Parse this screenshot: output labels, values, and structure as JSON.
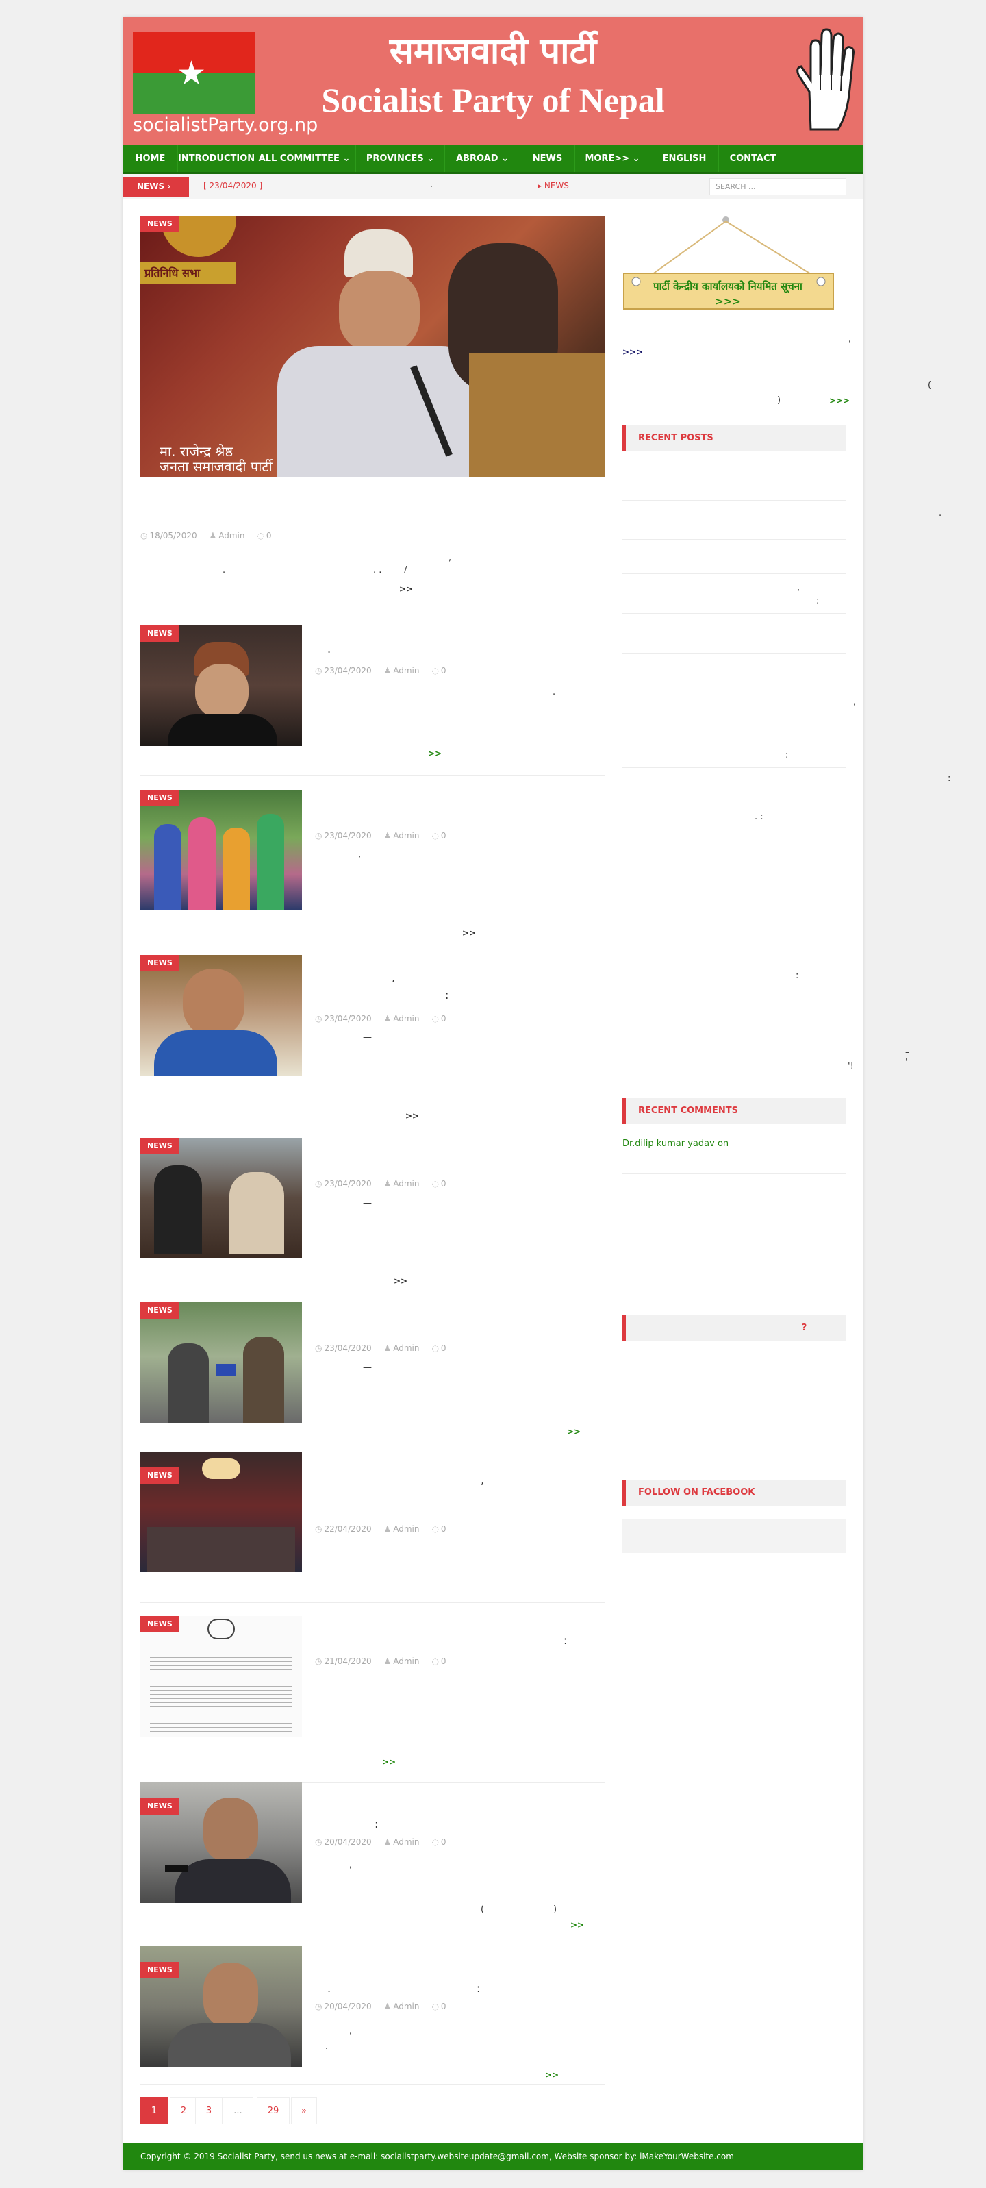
{
  "header": {
    "site_url": "socialistParty.org.np",
    "title_nepali": "समाजवादी पार्टी",
    "title_english": "Socialist Party of Nepal"
  },
  "nav": {
    "items": [
      {
        "label": "HOME"
      },
      {
        "label": "INTRODUCTION"
      },
      {
        "label": "ALL COMMITTEE"
      },
      {
        "label": "PROVINCES"
      },
      {
        "label": "ABROAD"
      },
      {
        "label": "NEWS"
      },
      {
        "label": "MORE>>"
      },
      {
        "label": "ENGLISH"
      },
      {
        "label": "CONTACT"
      }
    ]
  },
  "ticker": {
    "label": "NEWS",
    "date": "[ 23/04/2020 ]",
    "dot": ".",
    "next": "NEWS",
    "search_placeholder": "SEARCH ..."
  },
  "featured": {
    "badge": "NEWS",
    "caption_line1": "मा. राजेन्द्र श्रेष्ठ",
    "caption_line2": "जनता समाजवादी पार्टी",
    "screen_label": "प्रतिनिधि सभा",
    "date": "18/05/2020",
    "author": "Admin",
    "comments": "0",
    "frag1": ",",
    "frag2": ".",
    "frag3": ". .",
    "frag4": "/",
    "more": ">>"
  },
  "posts": [
    {
      "badge": "NEWS",
      "title": ".",
      "date": "23/04/2020",
      "author": "Admin",
      "comments": "0",
      "frag": ".",
      "more": ">>"
    },
    {
      "badge": "NEWS",
      "title": "",
      "date": "23/04/2020",
      "author": "Admin",
      "comments": "0",
      "frag": ",",
      "more": ">>"
    },
    {
      "badge": "NEWS",
      "title": ",",
      "title2": ":",
      "date": "23/04/2020",
      "author": "Admin",
      "comments": "0",
      "frag": "—",
      "more": ">>"
    },
    {
      "badge": "NEWS",
      "title": "",
      "date": "23/04/2020",
      "author": "Admin",
      "comments": "0",
      "frag": "—",
      "more": ">>"
    },
    {
      "badge": "NEWS",
      "title": "",
      "date": "23/04/2020",
      "author": "Admin",
      "comments": "0",
      "frag": "—",
      "more": ">>"
    },
    {
      "badge": "NEWS",
      "title": ",",
      "date": "22/04/2020",
      "author": "Admin",
      "comments": "0",
      "frag": "",
      "more": ""
    },
    {
      "badge": "NEWS",
      "title": ":",
      "date": "21/04/2020",
      "author": "Admin",
      "comments": "0",
      "frag": "",
      "more": ">>"
    },
    {
      "badge": "NEWS",
      "title": ":",
      "date": "20/04/2020",
      "author": "Admin",
      "comments": "0",
      "frag": ",",
      "frag2": "(",
      "frag3": ")",
      "more": ">>"
    },
    {
      "badge": "NEWS",
      "title": ".",
      "title2": ":",
      "date": "20/04/2020",
      "author": "Admin",
      "comments": "0",
      "frag": ",",
      "frag2": ".",
      "more": ">>"
    }
  ],
  "pagination": [
    "1",
    "2",
    "3",
    "...",
    "29",
    "»"
  ],
  "sidebar": {
    "notice": "पार्टी केन्द्रीय कार्यालयको नियमित सूचना >>>",
    "frag_comma": ",",
    "frag_more": ">>>",
    "frag_paren_open": "(",
    "frag_paren_close": ")",
    "frag_more2": ">>>",
    "recent_posts_title": "RECENT POSTS",
    "rp_frags": [
      ".",
      ",",
      ":",
      ",",
      ":",
      ":",
      ". :",
      "–",
      ":",
      "– '",
      "'!"
    ],
    "recent_comments_title": "RECENT COMMENTS",
    "comment_author": "Dr.dilip kumar yadav on",
    "widget3_title": "?",
    "facebook_title": "FOLLOW ON FACEBOOK"
  },
  "footer": {
    "text": "Copyright © 2019 Socialist Party, send us news at e-mail: socialistparty.websiteupdate@gmail.com, Website sponsor by: iMakeYourWebsite.com"
  },
  "colors": {
    "banner": "#e8706a",
    "nav_green": "#21870f",
    "accent_red": "#dd3a3f"
  }
}
